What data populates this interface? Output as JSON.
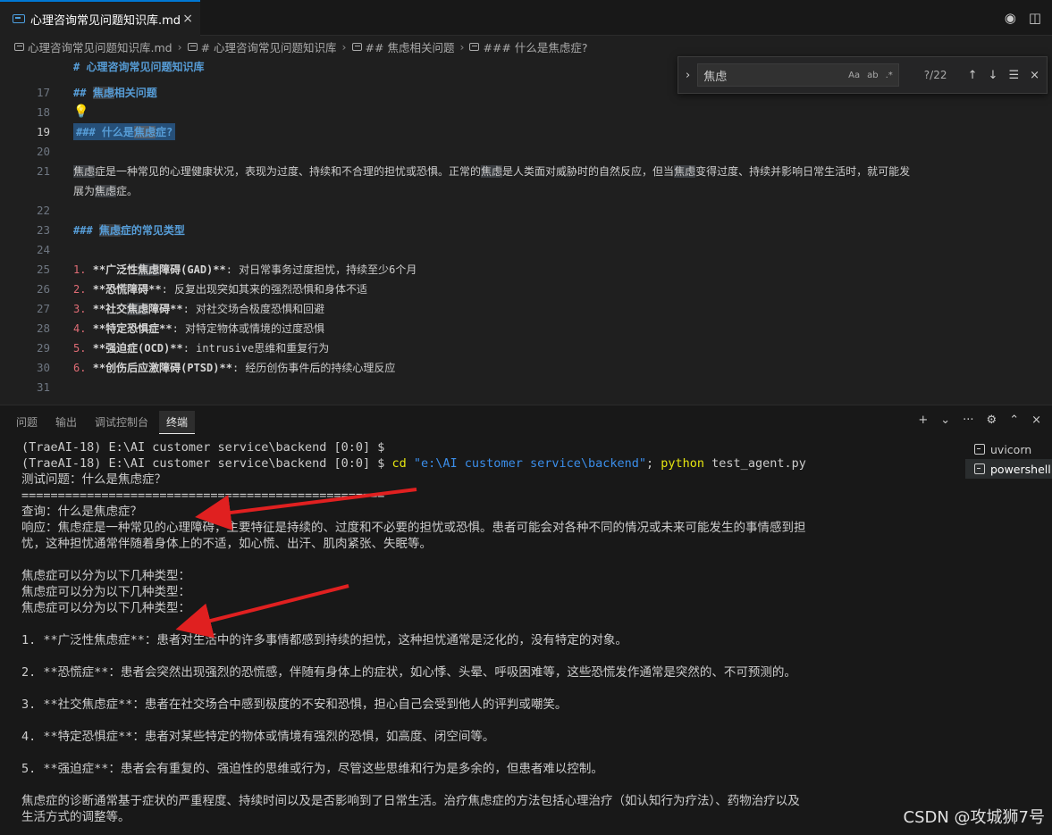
{
  "tab": {
    "title": "心理咨询常见问题知识库.md",
    "close": "×"
  },
  "top_actions": {
    "preview": "◉",
    "split": "◫"
  },
  "breadcrumb": [
    "心理咨询常见问题知识库.md",
    "# 心理咨询常见问题知识库",
    "## 焦虑相关问题",
    "### 什么是焦虑症?"
  ],
  "editor": {
    "sticky_header": "# 心理咨询常见问题知识库",
    "line_numbers": [
      "17",
      "18",
      "19",
      "20",
      "21",
      "",
      "22",
      "23",
      "24",
      "25",
      "26",
      "27",
      "28",
      "29",
      "30",
      "31"
    ],
    "l17": {
      "prefix": "## ",
      "hit": "焦虑",
      "rest": "相关问题"
    },
    "l19": {
      "prefix": "### ",
      "pre": "什么是",
      "hit": "焦虑",
      "rest": "症?"
    },
    "l21a": {
      "hit1": "焦虑",
      "t1": "症是一种常见的心理健康状况，表现为过度、持续和不合理的担忧或恐惧。正常的",
      "hit2": "焦虑",
      "t2": "是人类面对威胁时的自然反应，但当",
      "hit3": "焦虑",
      "t3": "变得过度、持续并影响日常生活时，就可能发"
    },
    "l21b": {
      "t1": "展为",
      "hit": "焦虑",
      "t2": "症。"
    },
    "l23": {
      "prefix": "### ",
      "hit": "焦虑",
      "rest": "症的常见类型"
    },
    "list": [
      {
        "n": "1.",
        "pre": "**广泛性",
        "hit": "焦虑",
        "post": "障碍(GAD)**",
        "desc": ": 对日常事务过度担忧，持续至少6个月"
      },
      {
        "n": "2.",
        "pre": "**恐慌障碍**",
        "hit": "",
        "post": "",
        "desc": ": 反复出现突如其来的强烈恐惧和身体不适"
      },
      {
        "n": "3.",
        "pre": "**社交",
        "hit": "焦虑",
        "post": "障碍**",
        "desc": ": 对社交场合极度恐惧和回避"
      },
      {
        "n": "4.",
        "pre": "**特定恐惧症**",
        "hit": "",
        "post": "",
        "desc": ": 对特定物体或情境的过度恐惧"
      },
      {
        "n": "5.",
        "pre": "**强迫症(OCD)**",
        "hit": "",
        "post": "",
        "desc": ":  intrusive思维和重复行为"
      },
      {
        "n": "6.",
        "pre": "**创伤后应激障碍(PTSD)**",
        "hit": "",
        "post": "",
        "desc": ": 经历创伤事件后的持续心理反应"
      }
    ]
  },
  "find": {
    "query": "焦虑",
    "opt_case": "Aa",
    "opt_word": "ab",
    "opt_regex": ".*",
    "count": "?/22",
    "up": "↑",
    "down": "↓",
    "sel": "☰",
    "close": "×"
  },
  "panel": {
    "tabs": [
      "问题",
      "输出",
      "调试控制台",
      "终端"
    ],
    "actions": {
      "add": "+",
      "dropdown": "⌄",
      "more": "···",
      "layout": "⚙",
      "max": "⌃",
      "close": "×"
    },
    "terminals": [
      "uvicorn",
      "powershell"
    ]
  },
  "terminal": {
    "prompt1": "(TraeAI-18) E:\\AI customer service\\backend [0:0] $",
    "prompt2": "(TraeAI-18) E:\\AI customer service\\backend [0:0] $ ",
    "cmd_cd": "cd ",
    "cmd_path": "\"e:\\AI customer service\\backend\"",
    "cmd_sep": "; ",
    "cmd_py": "python",
    "cmd_arg": " test_agent.py",
    "test_q": "测试问题：什么是焦虑症？",
    "rule": "==================================================",
    "query": "查询：什么是焦虑症？",
    "resp1": "响应：焦虑症是一种常见的心理障碍，主要特征是持续的、过度和不必要的担忧或恐惧。患者可能会对各种不同的情况或未来可能发生的事情感到担",
    "resp2": "忧，这种担忧通常伴随着身体上的不适，如心慌、出汗、肌肉紧张、失眠等。",
    "types1": "焦虑症可以分为以下几种类型：",
    "types2": "焦虑症可以分为以下几种类型：",
    "types3": "焦虑症可以分为以下几种类型：",
    "item1": "1. **广泛性焦虑症**：患者对生活中的许多事情都感到持续的担忧，这种担忧通常是泛化的，没有特定的对象。",
    "item2": "2. **恐慌症**：患者会突然出现强烈的恐慌感，伴随有身体上的症状，如心悸、头晕、呼吸困难等，这些恐慌发作通常是突然的、不可预测的。",
    "item3": "3. **社交焦虑症**：患者在社交场合中感到极度的不安和恐惧，担心自己会受到他人的评判或嘲笑。",
    "item4": "4. **特定恐惧症**：患者对某些特定的物体或情境有强烈的恐惧，如高度、闭空间等。",
    "item5": "5. **强迫症**：患者会有重复的、强迫性的思维或行为，尽管这些思维和行为是多余的，但患者难以控制。",
    "diag1": "焦虑症的诊断通常基于症状的严重程度、持续时间以及是否影响到了日常生活。治疗焦虑症的方法包括心理治疗（如认知行为疗法）、药物治疗以及",
    "diag2": "生活方式的调整等。"
  },
  "watermark": "CSDN @攻城狮7号",
  "colors": {
    "accent": "#0078d4",
    "arrow": "#e02020"
  }
}
